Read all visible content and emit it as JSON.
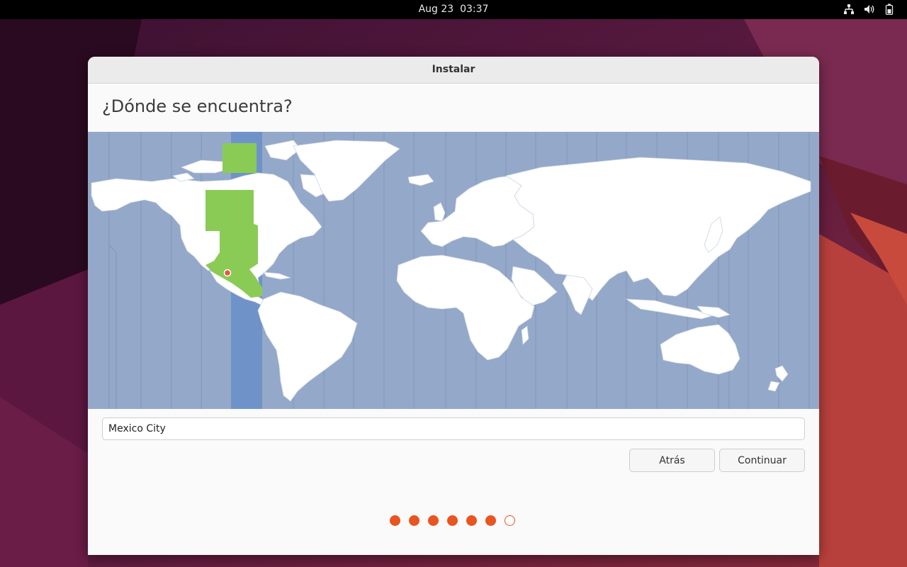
{
  "topbar": {
    "date": "Aug 23",
    "time": "03:37",
    "icons": [
      "network-icon",
      "volume-icon",
      "battery-icon"
    ]
  },
  "window": {
    "title": "Instalar",
    "heading": "¿Dónde se encuentra?",
    "timezone_map": {
      "selected_city": "Mexico City"
    },
    "location_input": {
      "value": "Mexico City"
    },
    "buttons": {
      "back": "Atrás",
      "continue": "Continuar"
    },
    "progress": {
      "total_steps": 7,
      "completed_steps": 6
    }
  },
  "colors": {
    "accent": "#e95420",
    "ocean": "#94a8c9",
    "land": "#ffffff",
    "selected_zone": "#6f93c8",
    "selected_region": "#8acb55"
  }
}
